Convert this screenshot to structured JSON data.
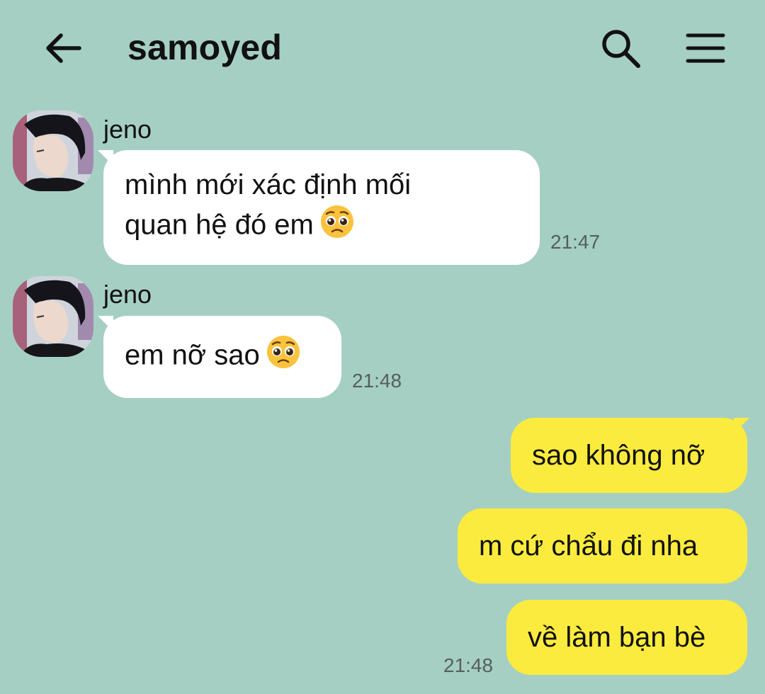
{
  "header": {
    "title": "samoyed",
    "back_icon": "arrow-left-icon",
    "search_icon": "search-icon",
    "menu_icon": "hamburger-menu-icon"
  },
  "colors": {
    "background": "#a6cfc3",
    "incoming_bubble": "#ffffff",
    "outgoing_bubble": "#fbeb3f",
    "timestamp": "#555f5b"
  },
  "messages": [
    {
      "direction": "incoming",
      "sender": "jeno",
      "lines": [
        "mình mới xác định mối",
        "quan hệ đó em"
      ],
      "emoji": "pleading-face",
      "time": "21:47"
    },
    {
      "direction": "incoming",
      "sender": "jeno",
      "lines": [
        "em nỡ sao"
      ],
      "emoji": "pleading-face",
      "time": "21:48"
    },
    {
      "direction": "outgoing",
      "text": "sao không nỡ"
    },
    {
      "direction": "outgoing",
      "text": "m cứ chẩu đi nha"
    },
    {
      "direction": "outgoing",
      "text": "về làm bạn bè",
      "time": "21:48"
    }
  ]
}
